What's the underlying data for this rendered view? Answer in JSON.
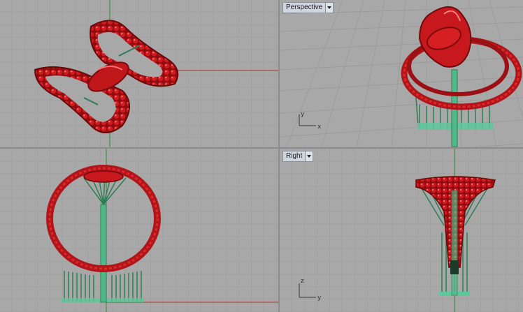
{
  "viewports": {
    "top": {
      "label": ""
    },
    "perspective": {
      "label": "Perspective",
      "axis_x": "x",
      "axis_y": "y"
    },
    "front": {
      "label": ""
    },
    "right": {
      "label": "Right",
      "axis_z": "z",
      "axis_y": "y"
    }
  },
  "colors": {
    "viewport_bg": "#a8a8a8",
    "grid_minor": "#9a9a9a",
    "grid_major": "#8a8a8a",
    "x_axis": "#b03030",
    "y_axis": "#2e8b2e",
    "ring_red": "#c0171b",
    "support_green": "#5ec89a",
    "label_bg": "#cfd6df"
  },
  "icons": [
    "chevron-down-icon",
    "ring-model-icon",
    "axis-gizmo-icon"
  ]
}
